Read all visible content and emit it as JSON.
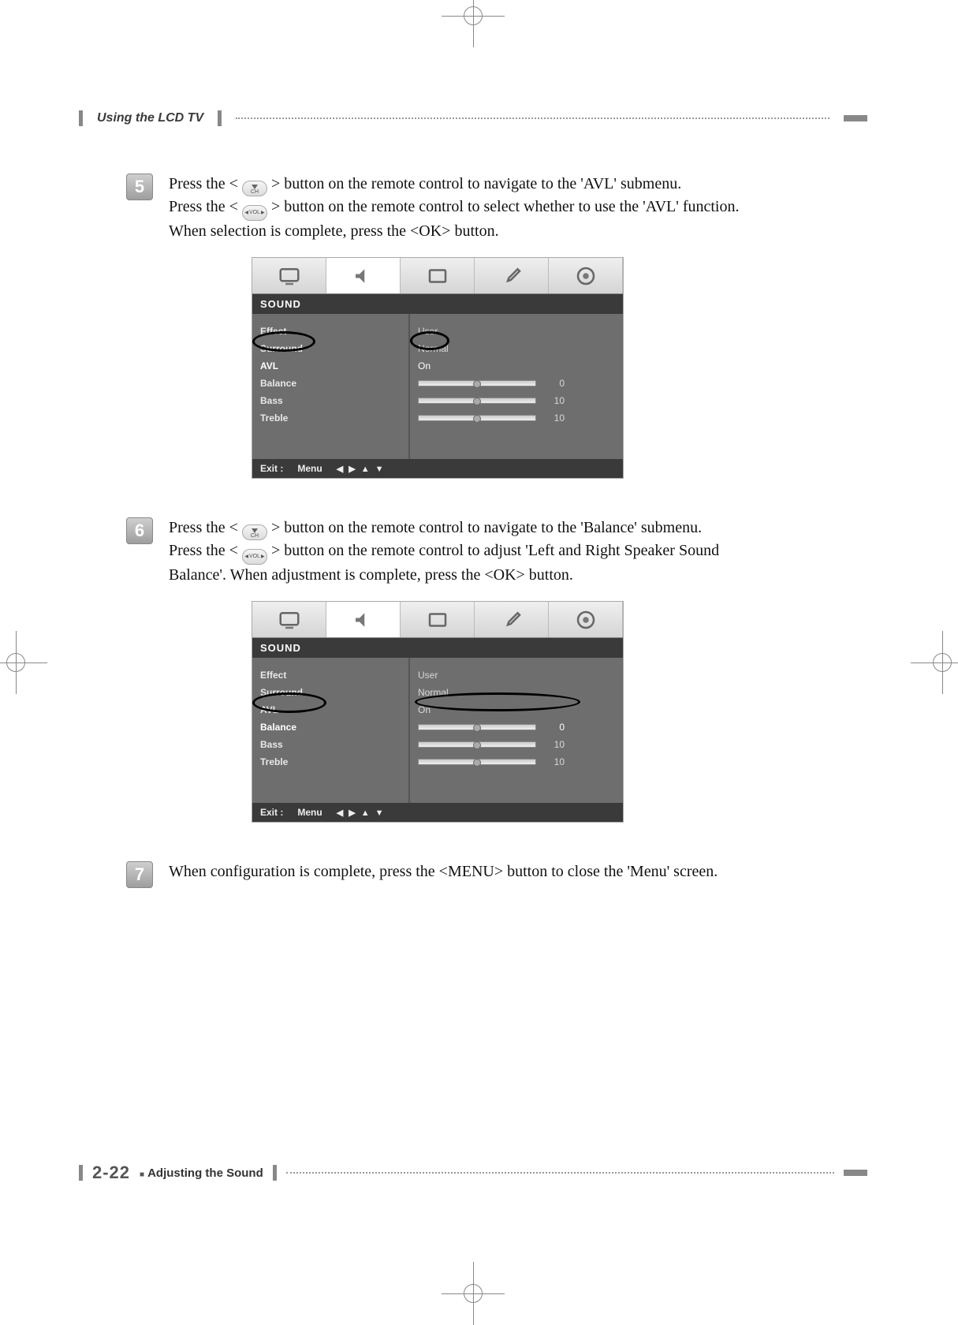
{
  "header": {
    "section": "Using the LCD TV"
  },
  "steps": {
    "s5": {
      "num": "5",
      "line1a": "Press the <",
      "line1b": "> button on the remote control to navigate to the 'AVL' submenu.",
      "line2a": "Press the <",
      "line2b": "> button on the remote control to select whether to use the 'AVL' function.",
      "line3": "When selection is complete, press the <OK> button."
    },
    "s6": {
      "num": "6",
      "line1a": "Press the <",
      "line1b": "> button on the remote control to navigate to the 'Balance' submenu.",
      "line2a": "Press the <",
      "line2b": "> button on the remote control to adjust 'Left and Right Speaker Sound",
      "line3": "Balance'. When adjustment is complete, press the <OK> button."
    },
    "s7": {
      "num": "7",
      "text": "When configuration is complete, press the <MENU> button to close the 'Menu' screen."
    }
  },
  "osd": {
    "title": "SOUND",
    "labels": {
      "effect": "Effect",
      "surround": "Surround",
      "avl": "AVL",
      "balance": "Balance",
      "bass": "Bass",
      "treble": "Treble"
    },
    "values": {
      "effect": "User",
      "surround": "Normal",
      "avl": "On",
      "balance": "0",
      "bass": "10",
      "treble": "10"
    },
    "footer": {
      "exit": "Exit :",
      "menu": "Menu",
      "arrows": "◀ ▶ ▲ ▼"
    }
  },
  "icons": {
    "ch_down": "CH",
    "vol": "VOL"
  },
  "footer": {
    "page": "2-22",
    "label": "Adjusting the Sound"
  }
}
